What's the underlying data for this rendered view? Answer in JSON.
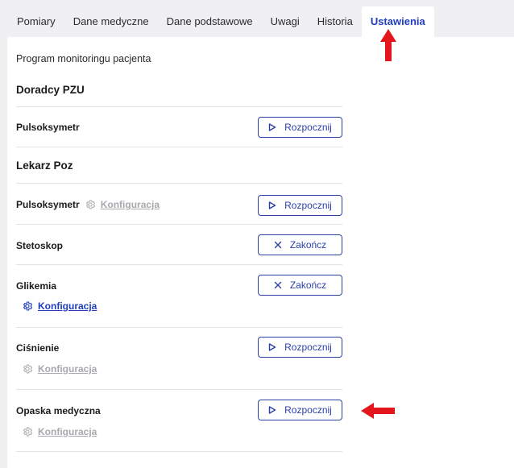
{
  "tabs": [
    {
      "label": "Pomiary"
    },
    {
      "label": "Dane medyczne"
    },
    {
      "label": "Dane podstawowe"
    },
    {
      "label": "Uwagi"
    },
    {
      "label": "Historia"
    },
    {
      "label": "Ustawienia",
      "active": true
    }
  ],
  "program_title": "Program monitoringu pacjenta",
  "groups": [
    {
      "title": "Doradcy PZU"
    },
    {
      "title": "Lekarz Poz"
    }
  ],
  "devices": [
    {
      "name": "Pulsoksymetr",
      "button": "Rozpocznij"
    },
    {
      "name": "Pulsoksymetr",
      "button": "Rozpocznij",
      "config": "Konfiguracja"
    },
    {
      "name": "Stetoskop",
      "button": "Zakończ"
    },
    {
      "name": "Glikemia",
      "button": "Zakończ",
      "config": "Konfiguracja"
    },
    {
      "name": "Ciśnienie",
      "button": "Rozpocznij",
      "config": "Konfiguracja"
    },
    {
      "name": "Opaska medyczna",
      "button": "Rozpocznij",
      "config": "Konfiguracja"
    }
  ],
  "colors": {
    "accent": "#1f3ebf",
    "annotation_arrow": "#e5161b",
    "disabled": "#a8a8ae"
  }
}
